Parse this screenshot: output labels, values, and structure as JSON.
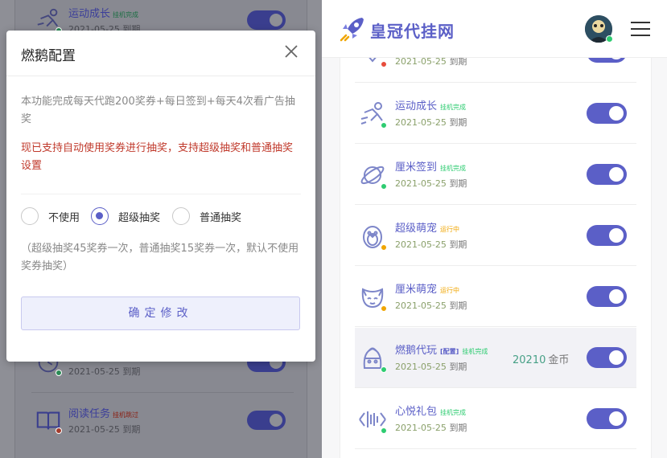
{
  "left": {
    "rows": [
      {
        "name": "运动成长",
        "status": "挂机完成",
        "date": "2021-05-25 到期"
      },
      {
        "name": "",
        "status": "",
        "date": "2021-05-25 到期"
      },
      {
        "name": "阅读任务",
        "status": "挂机跳过",
        "date": "2021-05-25 到期"
      }
    ],
    "dialog": {
      "title": "燃鹅配置",
      "desc1": "本功能完成每天代跑200奖券+每日签到+每天4次看广告抽奖",
      "desc2": "现已支持自动使用奖券进行抽奖，支持超级抽奖和普通抽奖设置",
      "options": [
        "不使用",
        "超级抽奖",
        "普通抽奖"
      ],
      "selected_option": "超级抽奖",
      "note": "（超级抽奖45奖券一次，普通抽奖15奖券一次，默认不使用奖券抽奖）",
      "confirm_label": "确定修改"
    }
  },
  "right": {
    "brand": "皇冠代挂网",
    "tasks": [
      {
        "name": "",
        "status": "",
        "date": "2021-05-25",
        "expire": "到期",
        "icon": "heart-icon",
        "dot": "#e74c3c"
      },
      {
        "name": "运动成长",
        "status": "挂机完成",
        "date": "2021-05-25",
        "expire": "到期",
        "icon": "runner-icon",
        "dot": "#2ecc71"
      },
      {
        "name": "厘米签到",
        "status": "挂机完成",
        "date": "2021-05-25",
        "expire": "到期",
        "icon": "planet-icon",
        "dot": "#2ecc71"
      },
      {
        "name": "超级萌宠",
        "status": "运行中",
        "date": "2021-05-25",
        "expire": "到期",
        "icon": "penguin-icon",
        "dot": "#f0a500"
      },
      {
        "name": "厘米萌宠",
        "status": "运行中",
        "date": "2021-05-25",
        "expire": "到期",
        "icon": "cat-icon",
        "dot": "#f0a500"
      },
      {
        "name": "燃鹅代玩",
        "config": "[配置]",
        "status": "挂机完成",
        "date": "2021-05-25",
        "expire": "到期",
        "icon": "goose-icon",
        "dot": "#2ecc71",
        "coins": "20210",
        "coin_unit": "金币"
      },
      {
        "name": "心悦礼包",
        "status": "挂机完成",
        "date": "2021-05-25",
        "expire": "到期",
        "icon": "wave-icon",
        "dot": "#2ecc71"
      }
    ]
  },
  "colors": {
    "accent": "#5b5fc7",
    "done": "#2ecc71",
    "running": "#f0a500",
    "error": "#c0392b"
  }
}
